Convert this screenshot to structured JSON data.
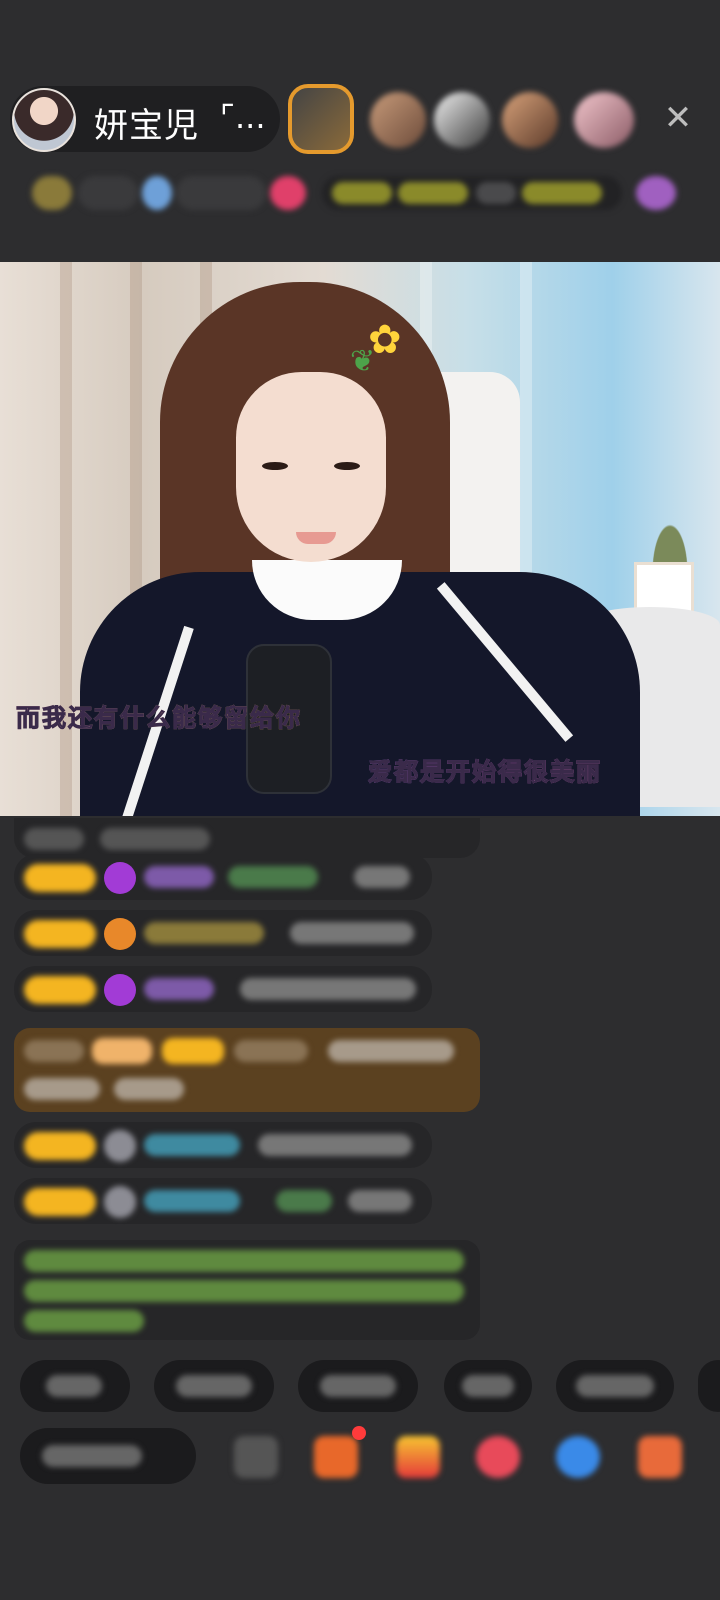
{
  "header": {
    "anchor_name": "妍宝児",
    "anchor_more": "⌜...",
    "close_icon": "close-icon"
  },
  "video": {
    "lyric_line_1": "而我还有什么能够留给你",
    "lyric_line_2": "爱都是开始得很美丽"
  },
  "colors": {
    "background": "#2d2d2f",
    "badge_gold": "#f4b521",
    "highlight_brown": "#5b4120",
    "chat_bubble": "#262628"
  }
}
